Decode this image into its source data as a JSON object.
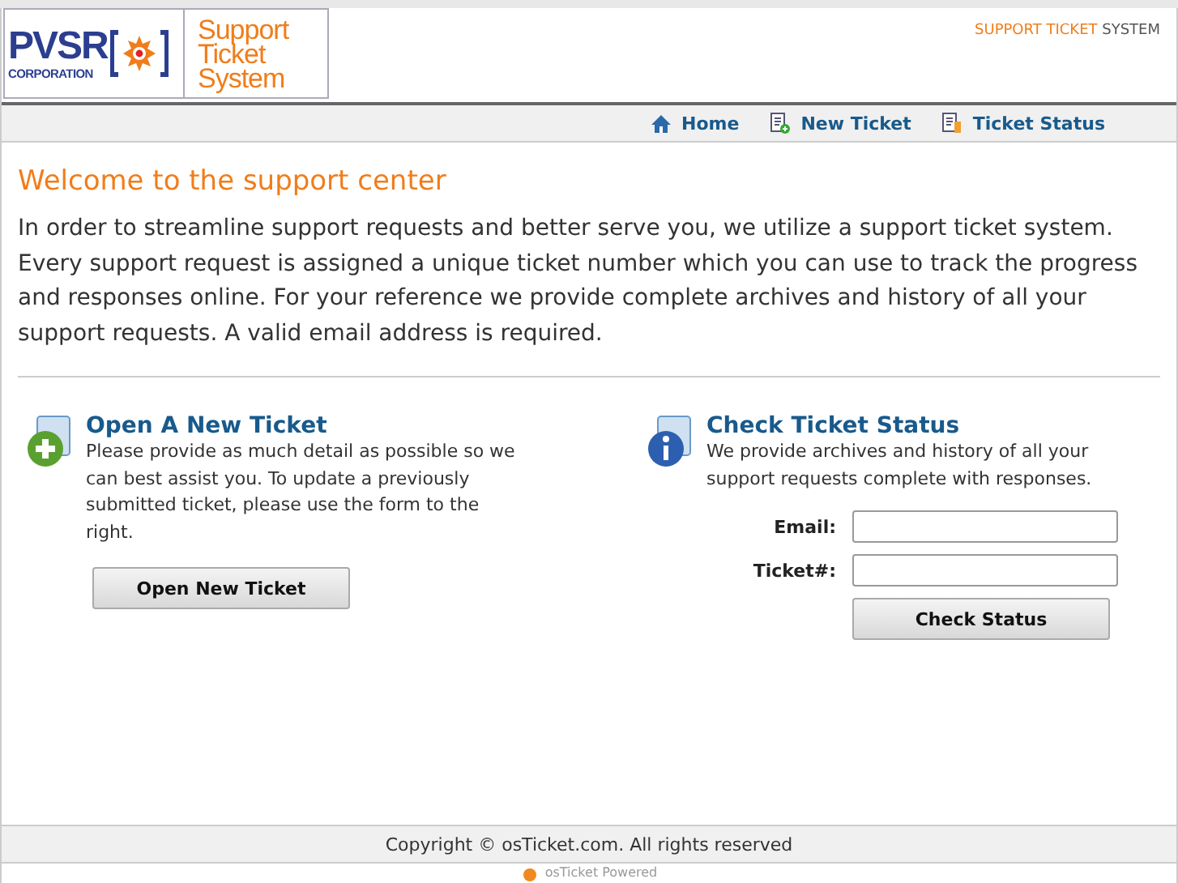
{
  "header": {
    "logo": {
      "company": "PVSR",
      "company_sub": "CORPORATION",
      "product_lines": [
        "Support",
        "Ticket",
        "System"
      ]
    },
    "tagline": {
      "highlight": "SUPPORT TICKET",
      "rest": "SYSTEM"
    }
  },
  "nav": [
    {
      "label": "Home",
      "kind": "home"
    },
    {
      "label": "New Ticket",
      "kind": "new"
    },
    {
      "label": "Ticket Status",
      "kind": "status"
    }
  ],
  "welcome": {
    "title": "Welcome to the support center",
    "text": "In order to streamline support requests and better serve you, we utilize a support ticket system. Every support request is assigned a unique ticket number which you can use to track the progress and responses online. For your reference we provide complete archives and history of all your support requests. A valid email address is required."
  },
  "open_ticket": {
    "title": "Open A New Ticket",
    "text": "Please provide as much detail as possible so we can best assist you. To update a previously submitted ticket, please use the form to the right.",
    "button": "Open New Ticket"
  },
  "check_status": {
    "title": "Check Ticket Status",
    "text": "We provide archives and history of all your support requests complete with responses.",
    "fields": [
      {
        "label": "Email:"
      },
      {
        "label": "Ticket#:"
      }
    ],
    "button": "Check Status"
  },
  "footer": {
    "copyright": "Copyright © osTicket.com. All rights reserved",
    "powered": "osTicket Powered"
  }
}
